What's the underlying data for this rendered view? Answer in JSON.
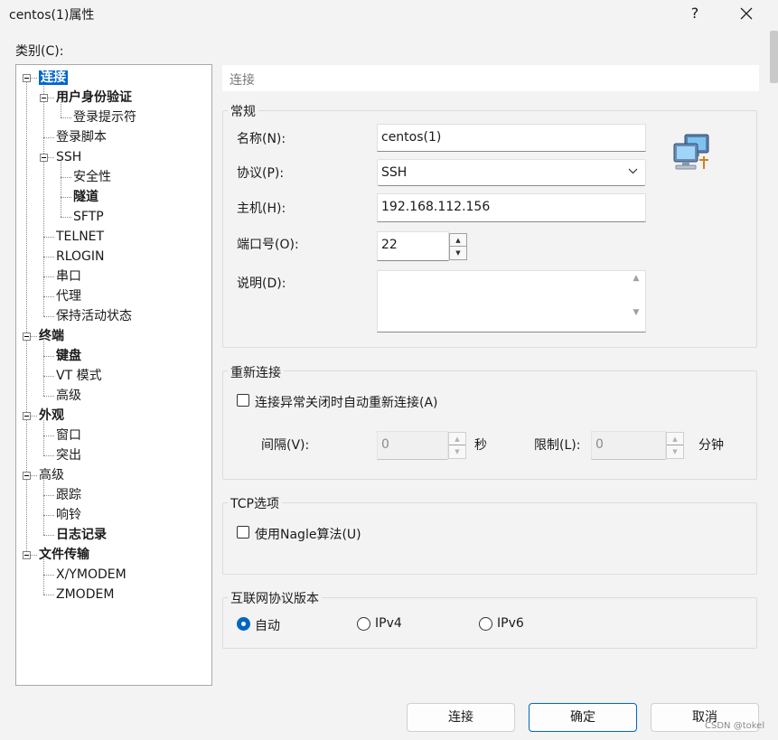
{
  "window": {
    "title": "centos(1)属性",
    "help": "?"
  },
  "category_label": "类别(C):",
  "tree": [
    {
      "label": "连接",
      "depth": 0,
      "bold": true,
      "selected": true,
      "expander": true
    },
    {
      "label": "用户身份验证",
      "depth": 1,
      "bold": true,
      "expander": true
    },
    {
      "label": "登录提示符",
      "depth": 2
    },
    {
      "label": "登录脚本",
      "depth": 1
    },
    {
      "label": "SSH",
      "depth": 1,
      "expander": true
    },
    {
      "label": "安全性",
      "depth": 2
    },
    {
      "label": "隧道",
      "depth": 2,
      "bold": true
    },
    {
      "label": "SFTP",
      "depth": 2
    },
    {
      "label": "TELNET",
      "depth": 1
    },
    {
      "label": "RLOGIN",
      "depth": 1
    },
    {
      "label": "串口",
      "depth": 1
    },
    {
      "label": "代理",
      "depth": 1
    },
    {
      "label": "保持活动状态",
      "depth": 1
    },
    {
      "label": "终端",
      "depth": 0,
      "bold": true,
      "expander": true
    },
    {
      "label": "键盘",
      "depth": 1,
      "bold": true
    },
    {
      "label": "VT 模式",
      "depth": 1
    },
    {
      "label": "高级",
      "depth": 1
    },
    {
      "label": "外观",
      "depth": 0,
      "bold": true,
      "expander": true
    },
    {
      "label": "窗口",
      "depth": 1
    },
    {
      "label": "突出",
      "depth": 1
    },
    {
      "label": "高级",
      "depth": 0,
      "expander": true
    },
    {
      "label": "跟踪",
      "depth": 1
    },
    {
      "label": "响铃",
      "depth": 1
    },
    {
      "label": "日志记录",
      "depth": 1,
      "bold": true
    },
    {
      "label": "文件传输",
      "depth": 0,
      "bold": true,
      "expander": true
    },
    {
      "label": "X/YMODEM",
      "depth": 1
    },
    {
      "label": "ZMODEM",
      "depth": 1
    }
  ],
  "section_header": "连接",
  "general": {
    "title": "常规",
    "name_label": "名称(N):",
    "name_value": "centos(1)",
    "protocol_label": "协议(P):",
    "protocol_value": "SSH",
    "host_label": "主机(H):",
    "host_value": "192.168.112.156",
    "port_label": "端口号(O):",
    "port_value": "22",
    "desc_label": "说明(D):",
    "desc_value": ""
  },
  "reconnect": {
    "title": "重新连接",
    "checkbox_label": "连接异常关闭时自动重新连接(A)",
    "checked": false,
    "interval_label": "间隔(V):",
    "interval_value": "0",
    "interval_unit": "秒",
    "limit_label": "限制(L):",
    "limit_value": "0",
    "limit_unit": "分钟"
  },
  "tcp": {
    "title": "TCP选项",
    "nagle_label": "使用Nagle算法(U)",
    "checked": false
  },
  "ip_version": {
    "title": "互联网协议版本",
    "options": [
      "自动",
      "IPv4",
      "IPv6"
    ],
    "selected": "自动"
  },
  "buttons": {
    "connect": "连接",
    "ok": "确定",
    "cancel": "取消"
  },
  "watermark": "CSDN @tokel",
  "colors": {
    "accent": "#0067c0",
    "selection": "#0066cc"
  }
}
